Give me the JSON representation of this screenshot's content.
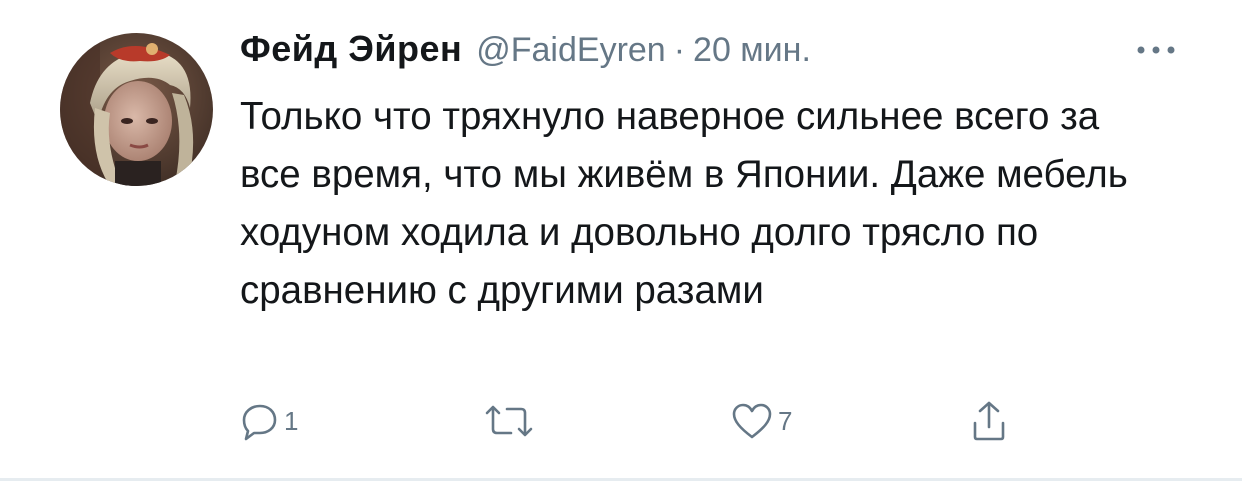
{
  "tweet": {
    "author": {
      "name": "Фейд Эйрен",
      "handle": "@FaidEyren"
    },
    "separator": "·",
    "time": "20 мин.",
    "text": "Только что тряхнуло наверное сильнее всего за все время, что мы живём в Японии. Даже мебель ходуном ходила и довольно долго трясло по сравнению с другими разами",
    "actions": {
      "reply_count": "1",
      "retweet_count": "",
      "like_count": "7"
    }
  },
  "icons": {
    "more": "more-dots-icon",
    "reply": "reply-icon",
    "retweet": "retweet-icon",
    "like": "heart-icon",
    "share": "share-icon"
  },
  "colors": {
    "text": "#14171a",
    "secondary": "#657786",
    "icon": "#657786",
    "divider": "#e6ecf0"
  }
}
